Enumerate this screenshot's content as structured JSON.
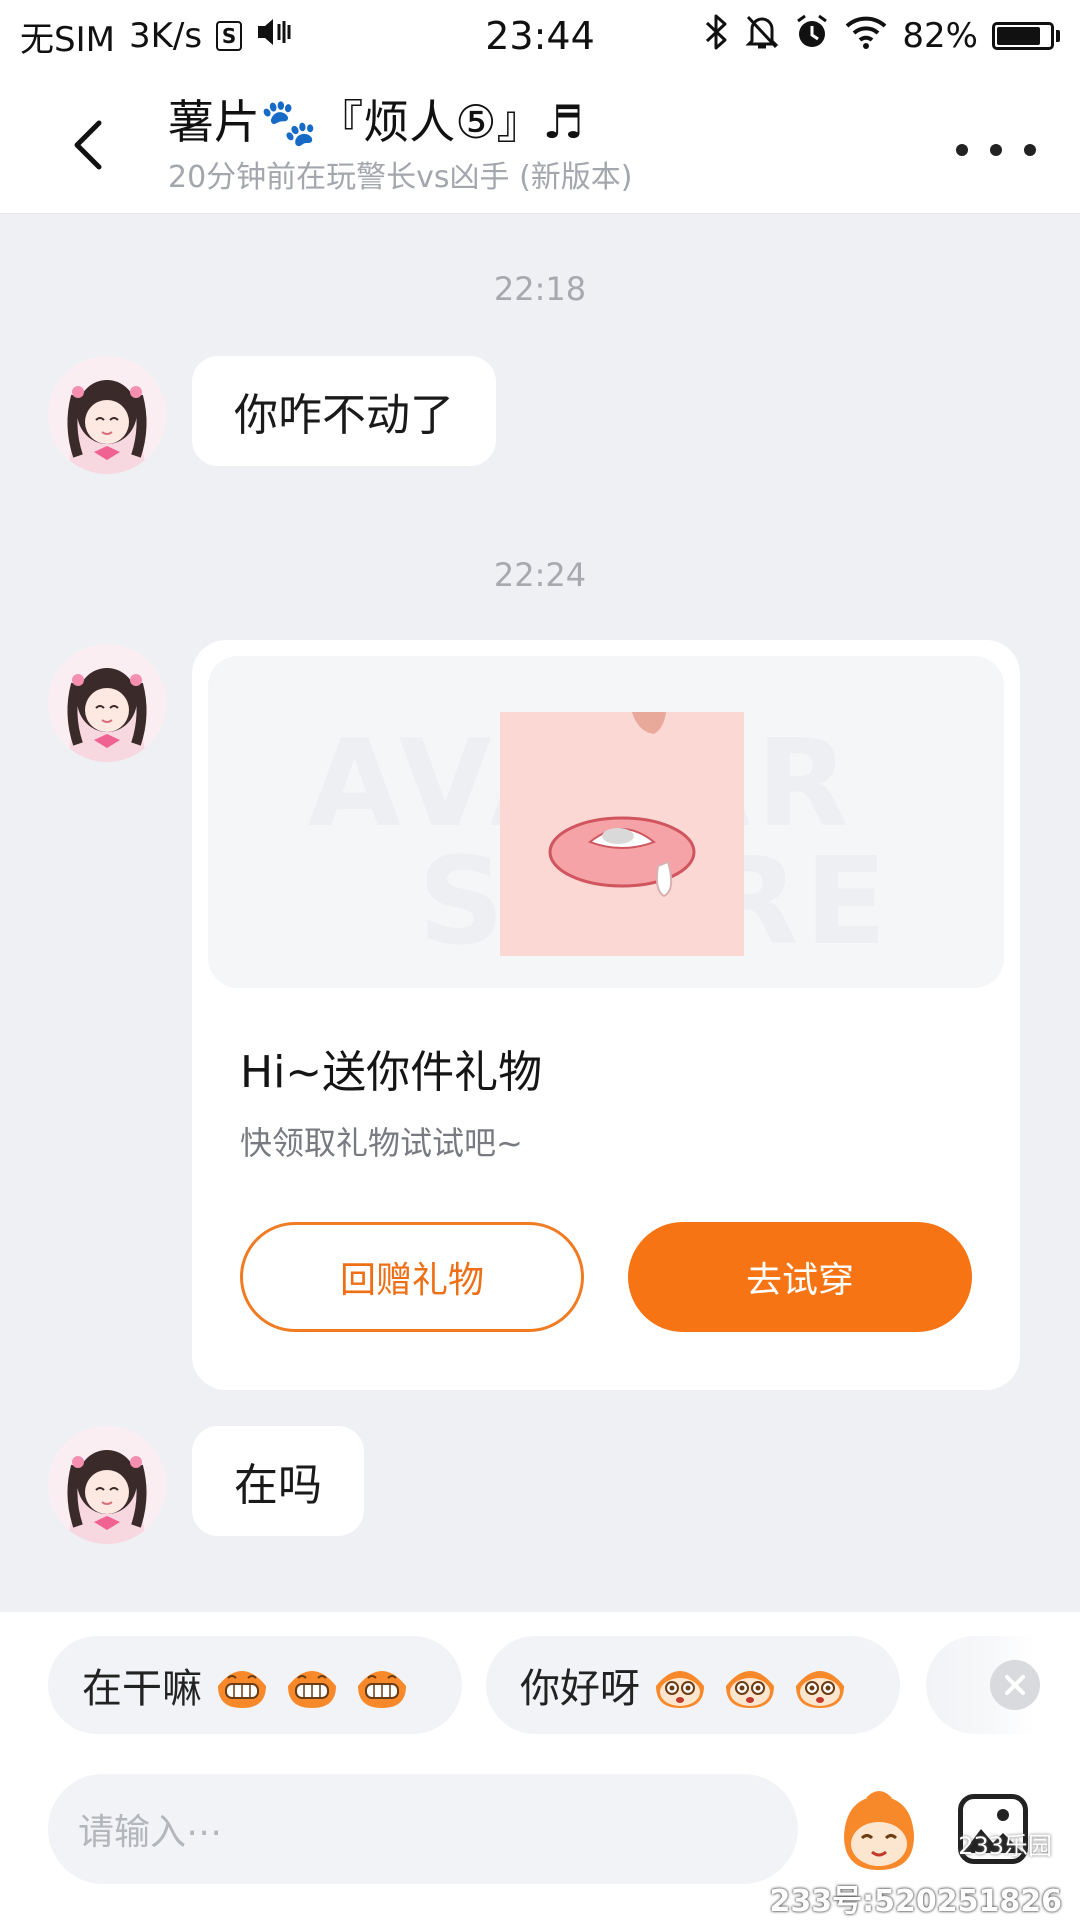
{
  "status_bar": {
    "carrier": "无SIM",
    "net_speed": "3K/s",
    "sim_box_letter": "S",
    "time": "23:44",
    "battery": "82%",
    "battery_level": 0.82
  },
  "header": {
    "title": "薯片🐾『烦人⑤』♬",
    "subtitle": "20分钟前在玩警长vs凶手 (新版本)"
  },
  "messages": [
    {
      "timestamp": "22:18",
      "text": "你咋不动了"
    },
    {
      "timestamp": "22:24"
    },
    {
      "text": "在吗"
    }
  ],
  "gift_card": {
    "banner_watermark_line1": "AVATAR",
    "banner_watermark_line2": "STORE",
    "title": "Hi~送你件礼物",
    "description": "快领取礼物试试吧~",
    "return_gift_label": "回赠礼物",
    "try_on_label": "去试穿"
  },
  "quick_replies": [
    {
      "text": "在干嘛",
      "emoji": "grinning-mascot"
    },
    {
      "text": "你好呀",
      "emoji": "wide-eyed-mascot"
    }
  ],
  "input": {
    "placeholder": "请输入⋯"
  },
  "watermark": {
    "logo": "233乐园",
    "id": "233号:520251826"
  },
  "colors": {
    "accent": "#f77414",
    "background": "#eef0f4"
  }
}
